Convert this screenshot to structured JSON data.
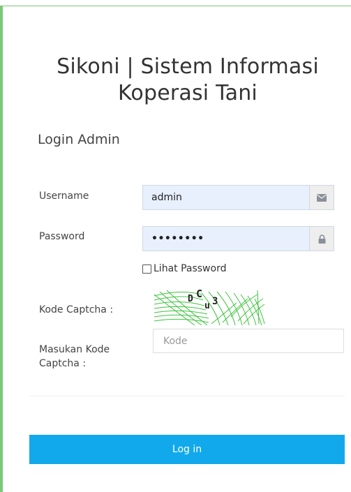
{
  "header": {
    "title_line1": "Sikoni | Sistem Informasi",
    "title_line2": "Koperasi Tani"
  },
  "form": {
    "heading": "Login Admin",
    "username_label": "Username",
    "username_value": "admin",
    "username_icon": "envelope-icon",
    "password_label": "Password",
    "password_masked": "••••••••",
    "password_icon": "lock-icon",
    "show_password_label": "Lihat Password",
    "show_password_checked": false,
    "captcha_label": "Kode Captcha :",
    "captcha_text": "DCu3",
    "captcha_input_label": "Masukan Kode Captcha :",
    "captcha_input_placeholder": "Kode",
    "submit_label": "Log in"
  },
  "colors": {
    "accent_border": "#79c978",
    "button": "#12a9ec",
    "input_fill": "#e8f0fe",
    "captcha_lines": "#3cc43c"
  }
}
